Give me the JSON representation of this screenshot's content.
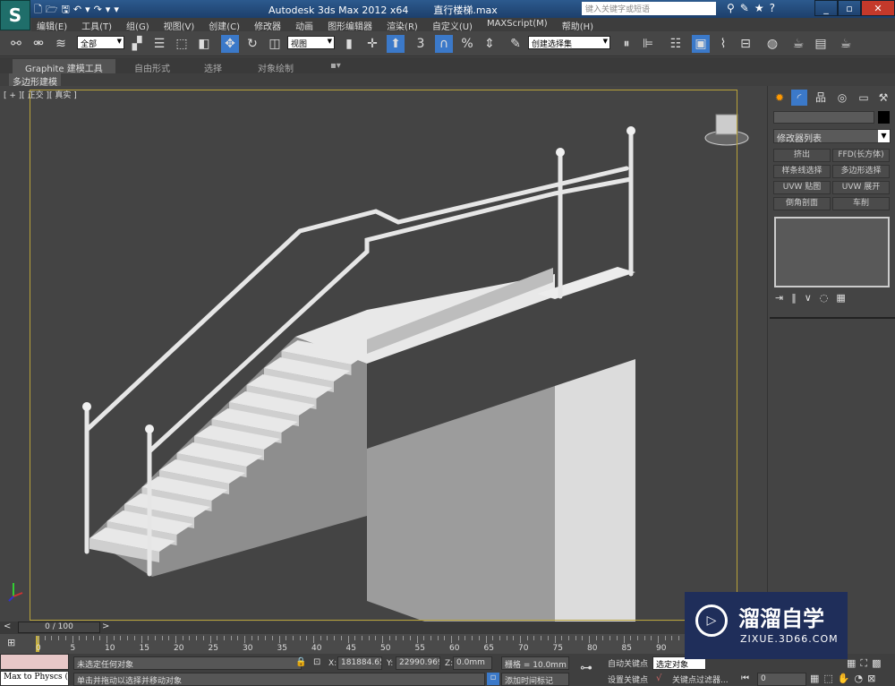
{
  "app": {
    "title": "Autodesk 3ds Max  2012 x64",
    "file": "直行楼梯.max",
    "search_placeholder": "键入关键字或短语",
    "logo": "S"
  },
  "menu": [
    "编辑(E)",
    "工具(T)",
    "组(G)",
    "视图(V)",
    "创建(C)",
    "修改器",
    "动画",
    "图形编辑器",
    "渲染(R)",
    "自定义(U)",
    "MAXScript(M)",
    "帮助(H)"
  ],
  "toolbar": {
    "selection_filter": "全部",
    "ref_coord": "视图",
    "named_selection": "创建选择集",
    "snap_label": "3"
  },
  "ribbon": {
    "tabs": [
      "Graphite 建模工具",
      "自由形式",
      "选择",
      "对象绘制"
    ],
    "sub": "多边形建模"
  },
  "viewport": {
    "label": "[ + ][ 正交 ][ 真实 ]"
  },
  "panel": {
    "modifier_list": "修改器列表",
    "buttons": [
      "挤出",
      "FFD(长方体)",
      "样条线选择",
      "多边形选择",
      "UVW 贴图",
      "UVW 展开",
      "倒角剖面",
      "车削"
    ]
  },
  "timeline": {
    "frame": "0 / 100",
    "ticks": [
      "0",
      "5",
      "10",
      "15",
      "20",
      "25",
      "30",
      "35",
      "40",
      "45",
      "50",
      "55",
      "60",
      "65",
      "70",
      "75",
      "80",
      "85",
      "90"
    ]
  },
  "status": {
    "script_line": "Max to Physcs (",
    "selection": "未选定任何对象",
    "prompt": "单击并拖动以选择并移动对象",
    "x_label": "X:",
    "x": "181884.65",
    "y_label": "Y:",
    "y": "22990.969",
    "z_label": "Z:",
    "z": "0.0mm",
    "grid": "栅格 = 10.0mm",
    "add_tag": "添加时间标记",
    "auto_key": "自动关键点",
    "set_key": "设置关键点",
    "key_mode": "选定对象",
    "key_filter": "关键点过滤器...",
    "frame_value": "0"
  },
  "watermark": {
    "name": "溜溜自学",
    "url": "ZIXUE.3D66.COM"
  },
  "colors": {
    "viewport_border": "#b8a23a",
    "active_tool": "#3b79c9"
  }
}
